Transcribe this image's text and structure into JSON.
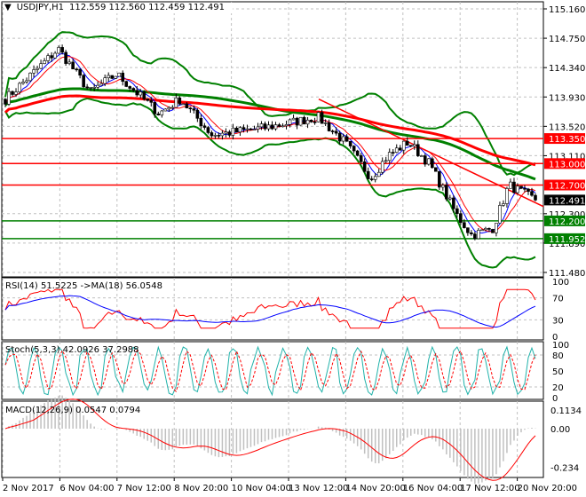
{
  "chart_data": {
    "type": "candlestick",
    "title": "USDJPY,H1",
    "ohlc_label": "112.559 112.560 112.459 112.491",
    "y_ticks": [
      "115.160",
      "114.750",
      "114.340",
      "113.930",
      "113.520",
      "113.110",
      "112.300",
      "111.890",
      "111.480"
    ],
    "ylim": [
      111.48,
      115.16
    ],
    "x_ticks": [
      "2 Nov 2017",
      "6 Nov 04:00",
      "7 Nov 12:00",
      "8 Nov 20:00",
      "10 Nov 04:00",
      "13 Nov 12:00",
      "14 Nov 20:00",
      "16 Nov 04:00",
      "17 Nov 12:00",
      "20 Nov 20:00"
    ],
    "current_price": {
      "label": "112.491",
      "value": 112.491,
      "color": "#000000"
    },
    "levels": [
      {
        "label": "113.350",
        "value": 113.35,
        "color": "#ff0000"
      },
      {
        "label": "113.000",
        "value": 113.0,
        "color": "#ff0000"
      },
      {
        "label": "112.700",
        "value": 112.7,
        "color": "#ff0000"
      },
      {
        "label": "112.200",
        "value": 112.2,
        "color": "#008000"
      },
      {
        "label": "111.952",
        "value": 111.952,
        "color": "#008000"
      }
    ],
    "close_path_approx": [
      [
        0,
        113.9
      ],
      [
        0.1,
        114.6
      ],
      [
        0.16,
        114.0
      ],
      [
        0.21,
        114.25
      ],
      [
        0.29,
        113.7
      ],
      [
        0.33,
        113.9
      ],
      [
        0.39,
        113.4
      ],
      [
        0.49,
        113.5
      ],
      [
        0.59,
        113.65
      ],
      [
        0.64,
        113.3
      ],
      [
        0.69,
        112.8
      ],
      [
        0.72,
        113.1
      ],
      [
        0.76,
        113.3
      ],
      [
        0.8,
        113.0
      ],
      [
        0.85,
        112.3
      ],
      [
        0.88,
        112.0
      ],
      [
        0.92,
        112.1
      ],
      [
        0.95,
        112.7
      ],
      [
        1,
        112.491
      ]
    ],
    "trendline": [
      [
        0.59,
        113.9
      ],
      [
        1,
        112.4
      ]
    ],
    "rsi": {
      "label": "RSI(14) 51.5225  ->MA(18) 56.0548",
      "ticks": [
        "100",
        "70",
        "30",
        "0"
      ],
      "levels": [
        70,
        30
      ]
    },
    "stoch": {
      "label": "Stoch(5,3,3) 42.0926 37.2988",
      "ticks": [
        "100",
        "80",
        "50",
        "20",
        "0"
      ],
      "levels": [
        80,
        20
      ]
    },
    "macd": {
      "label": "MACD(12,26,9) 0.0547 0.0794",
      "ticks": [
        "0.1134",
        "0.00",
        "-0.234"
      ],
      "range": [
        -0.234,
        0.1134
      ]
    },
    "colors": {
      "bull": "#000000",
      "bear": "#000000",
      "bollinger": "#008000",
      "ma_fast": "#ff0000",
      "ma_slow": "#008000",
      "ma_long": "#ff0000",
      "rsi": "#ff0000",
      "rsi_ma": "#0000ff",
      "stoch_main": "#20b2aa",
      "stoch_signal": "#ff0000",
      "macd_hist": "#c0c0c0",
      "macd_signal": "#ff0000"
    }
  }
}
